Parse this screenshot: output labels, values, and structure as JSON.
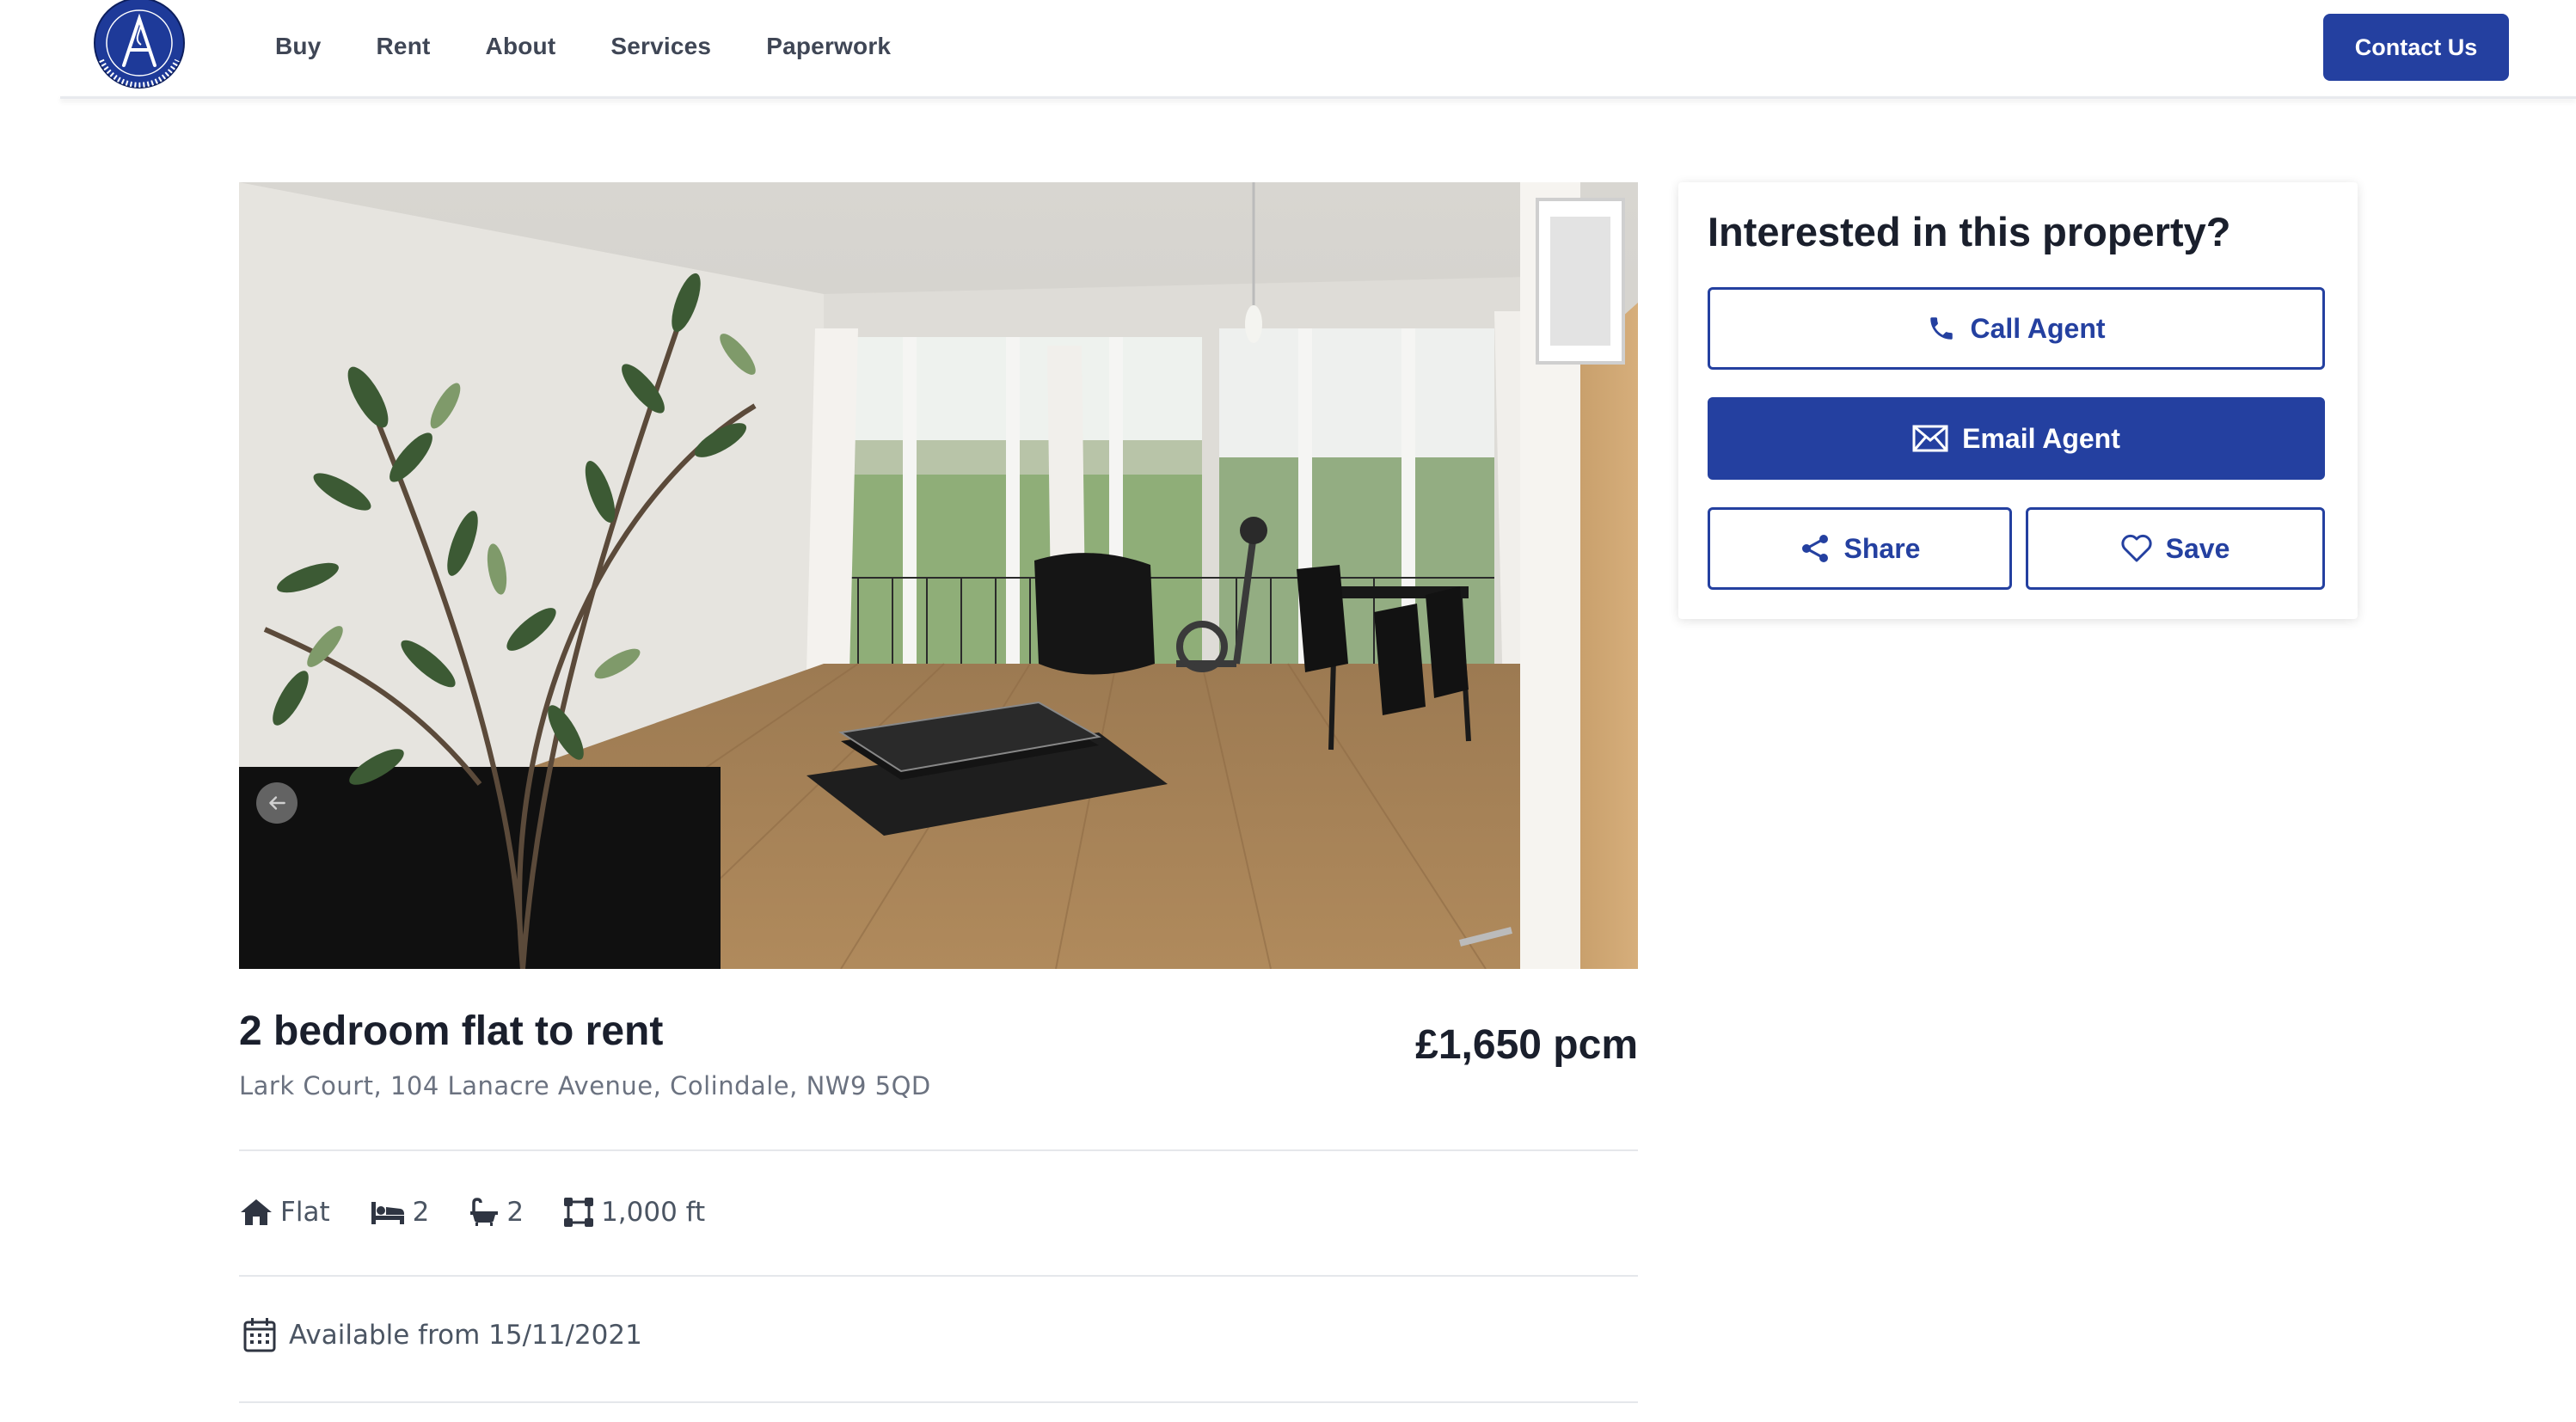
{
  "header": {
    "logo": {
      "line1": "AA PROPERTY",
      "line2": "LETTERS LTD",
      "ring": "CONFIDENTIALITY GUARANTEED",
      "monogram": "A"
    },
    "nav": [
      {
        "label": "Buy"
      },
      {
        "label": "Rent"
      },
      {
        "label": "About"
      },
      {
        "label": "Services"
      },
      {
        "label": "Paperwork"
      }
    ],
    "contact_label": "Contact Us"
  },
  "gallery": {
    "icons": {
      "prev": "arrow-left-icon",
      "next": "arrow-right-icon"
    },
    "slide_count": 3,
    "active_slide": 1
  },
  "listing": {
    "title": "2 bedroom flat to rent",
    "address": "Lark Court, 104 Lanacre Avenue, Colindale, NW9 5QD",
    "price": "£1,650 pcm",
    "features": [
      {
        "icon": "home-icon",
        "value": "Flat"
      },
      {
        "icon": "bed-icon",
        "value": "2"
      },
      {
        "icon": "bath-icon",
        "value": "2"
      },
      {
        "icon": "area-icon",
        "value": "1,000 ft"
      }
    ],
    "availability": {
      "icon": "calendar-icon",
      "text": "Available from 15/11/2021"
    }
  },
  "enquiry": {
    "title": "Interested in this property?",
    "call_label": "Call Agent",
    "email_label": "Email Agent",
    "share_label": "Share",
    "save_label": "Save"
  },
  "colors": {
    "brand": "#2440a0",
    "text_dark": "#1a1f2c",
    "text_muted": "#6b7280",
    "divider": "#e5e7eb"
  }
}
